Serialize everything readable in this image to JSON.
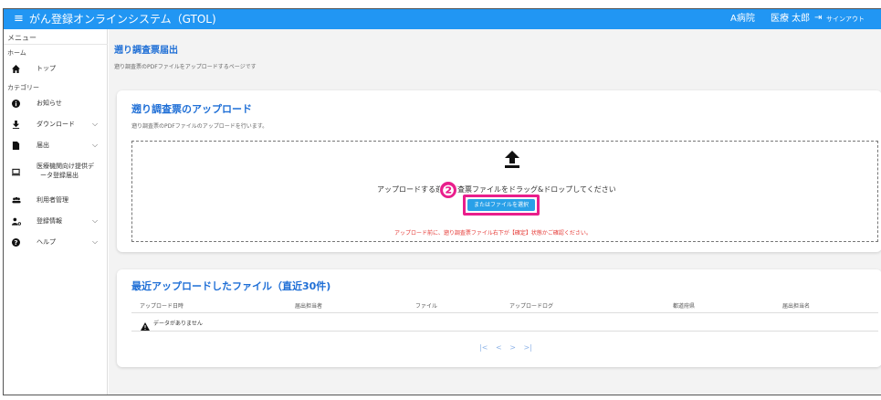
{
  "app": {
    "title": "がん登録オンラインシステム（GTOL)",
    "menu_icon": "hamburger-icon",
    "hospital": "A病院",
    "user": "医療 太郎",
    "signout_icon": "signout-icon",
    "signout_label": "サインアウト",
    "brand_color": "#2196f3"
  },
  "sidebar": {
    "menu_label": "メニュー",
    "home_label": "ホーム",
    "category_label": "カテゴリー",
    "items": [
      {
        "label": "トップ",
        "icon": "home-icon"
      },
      {
        "label": "お知らせ",
        "icon": "info-icon"
      },
      {
        "label": "ダウンロード",
        "icon": "download-icon",
        "expandable": true
      },
      {
        "label": "届出",
        "icon": "document-icon",
        "expandable": true
      },
      {
        "label": "医療機関向け提供デ",
        "label2": "ータ登録届出",
        "icon": "monitor-icon"
      },
      {
        "label": "利用者管理",
        "icon": "users-icon"
      },
      {
        "label": "登録情報",
        "icon": "user-settings-icon",
        "expandable": true
      },
      {
        "label": "ヘルプ",
        "icon": "help-icon",
        "expandable": true
      }
    ]
  },
  "page": {
    "title": "遡り調査票届出",
    "subtitle": "遡り調査票のPDFファイルをアップロードするページです"
  },
  "upload_card": {
    "title": "遡り調査票のアップロード",
    "subtitle": "遡り調査票のPDFファイルのアップロードを行います。",
    "drop_text": "アップロードする遡り調査票ファイルをドラッグ&ドロップしてください",
    "select_button": "またはファイルを選択",
    "warning": "アップロード前に、遡り調査票ファイル右下が【確定】状態かご確認ください。",
    "step_badge": "❷",
    "highlight_color": "#e91e8c"
  },
  "recent_card": {
    "title": "最近アップロードしたファイル（直近30件)",
    "columns": [
      "アップロード日時",
      "届出担当者",
      "ファイル",
      "アップロードログ",
      "都道府県",
      "届出担当名"
    ],
    "no_data": "データがありません",
    "pager": [
      "|<",
      "<",
      ">",
      ">|"
    ]
  }
}
